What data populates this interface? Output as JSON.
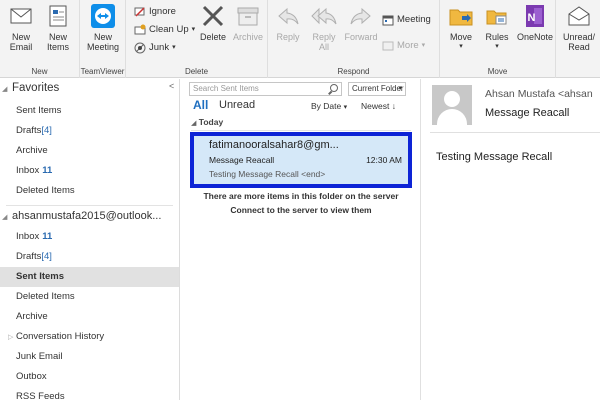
{
  "ribbon": {
    "new_group": {
      "label": "New",
      "new_email": "New Email",
      "new_items": "New Items"
    },
    "teamviewer_group": {
      "label": "TeamViewer",
      "new_meeting": "New Meeting"
    },
    "delete_group": {
      "label": "Delete",
      "ignore": "Ignore",
      "clean_up": "Clean Up",
      "junk": "Junk",
      "delete": "Delete",
      "archive": "Archive"
    },
    "respond_group": {
      "label": "Respond",
      "reply": "Reply",
      "reply_all": "Reply All",
      "forward": "Forward",
      "meeting": "Meeting",
      "more": "More"
    },
    "move_group": {
      "label": "Move",
      "move": "Move",
      "rules": "Rules",
      "onenote": "OneNote"
    },
    "tags_group": {
      "unread_read": "Unread/ Read"
    }
  },
  "folders": {
    "favorites_label": "Favorites",
    "favorites": [
      {
        "name": "Sent Items",
        "count": ""
      },
      {
        "name": "Drafts",
        "count": "[4]"
      },
      {
        "name": "Archive",
        "count": ""
      },
      {
        "name": "Inbox",
        "count": "11"
      },
      {
        "name": "Deleted Items",
        "count": ""
      }
    ],
    "account": "ahsanmustafa2015@outlook...",
    "account_folders": [
      {
        "name": "Inbox",
        "count": "11"
      },
      {
        "name": "Drafts",
        "count": "[4]"
      },
      {
        "name": "Sent Items",
        "count": ""
      },
      {
        "name": "Deleted Items",
        "count": ""
      },
      {
        "name": "Archive",
        "count": ""
      },
      {
        "name": "Conversation History",
        "count": ""
      },
      {
        "name": "Junk Email",
        "count": ""
      },
      {
        "name": "Outbox",
        "count": ""
      },
      {
        "name": "RSS Feeds",
        "count": ""
      }
    ]
  },
  "list": {
    "search_placeholder": "Search Sent Items",
    "scope": "Current Folder",
    "tab_all": "All",
    "tab_unread": "Unread",
    "sort_by": "By Date",
    "sort_order": "Newest",
    "group_today": "Today",
    "message": {
      "from": "fatimanooralsahar8@gm...",
      "subject": "Message Reacall",
      "time": "12:30 AM",
      "preview": "Testing Message Recall <end>"
    },
    "more_items": "There are more items in this folder on the server",
    "connect": "Connect to the server to view them"
  },
  "reading": {
    "sender": "Ahsan Mustafa <ahsan",
    "subject": "Message Reacall",
    "body": "Testing Message Recall"
  },
  "colors": {
    "accent": "#1f6fc0",
    "selection_border": "#0d24d6",
    "selection_fill": "#d5e8f8"
  }
}
